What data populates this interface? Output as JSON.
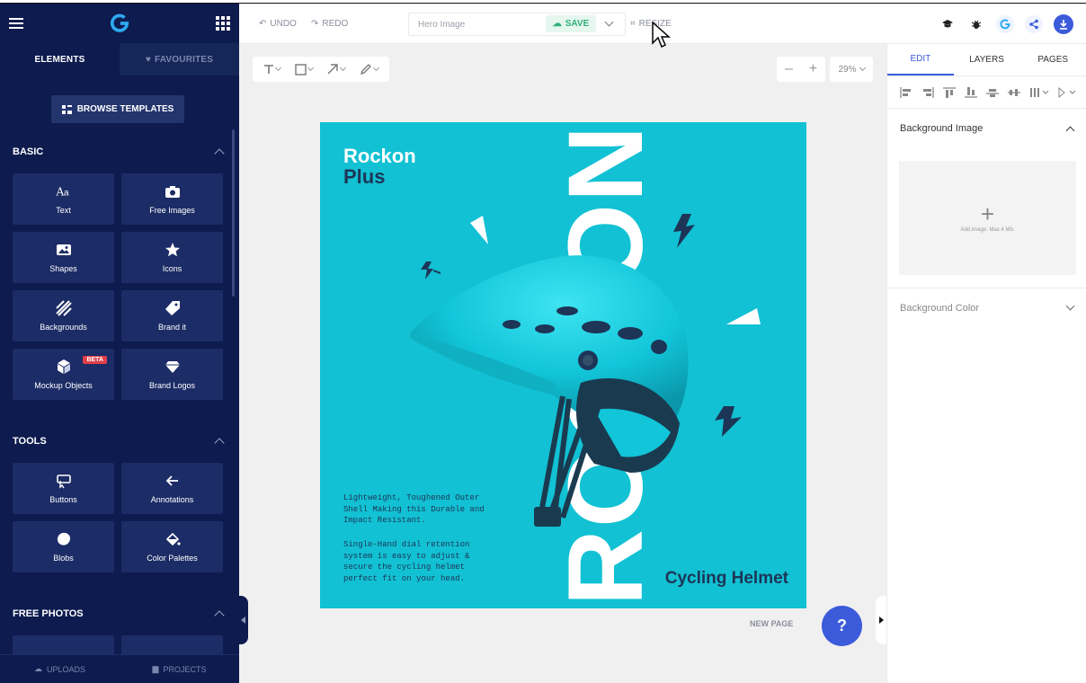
{
  "sidebar": {
    "tabs": {
      "elements": "ELEMENTS",
      "favourites": "FAVOURITES"
    },
    "browse_templates": "BROWSE TEMPLATES",
    "basic": {
      "title": "BASIC",
      "items": [
        {
          "label": "Text",
          "icon": "text-icon"
        },
        {
          "label": "Free Images",
          "icon": "camera-icon"
        },
        {
          "label": "Shapes",
          "icon": "image-icon"
        },
        {
          "label": "Icons",
          "icon": "star-icon"
        },
        {
          "label": "Backgrounds",
          "icon": "stripes-icon"
        },
        {
          "label": "Brand it",
          "icon": "tag-icon"
        },
        {
          "label": "Mockup Objects",
          "icon": "cube-icon",
          "badge": "BETA"
        },
        {
          "label": "Brand Logos",
          "icon": "diamond-icon"
        }
      ]
    },
    "tools": {
      "title": "TOOLS",
      "items": [
        {
          "label": "Buttons",
          "icon": "cursor-box-icon"
        },
        {
          "label": "Annotations",
          "icon": "arrow-left-icon"
        },
        {
          "label": "Blobs",
          "icon": "blob-icon"
        },
        {
          "label": "Color Palettes",
          "icon": "paint-bucket-icon"
        }
      ]
    },
    "free_photos": {
      "title": "FREE PHOTOS"
    },
    "bottom": {
      "uploads": "UPLOADS",
      "projects": "PROJECTS"
    }
  },
  "topbar": {
    "undo": "UNDO",
    "redo": "REDO",
    "doc_name": "Hero Image",
    "save": "SAVE",
    "resize": "RESIZE"
  },
  "canvas": {
    "zoom": "29%",
    "new_page": "NEW PAGE",
    "help": "?"
  },
  "design": {
    "title_line1": "Rockon",
    "title_line2": "Plus",
    "big_word": "ROCKON",
    "para1": "Lightweight, Toughened Outer Shell Making this Durable and Impact Resistant.",
    "para2": "Single-Hand dial retention system is easy to adjust & secure the cycling helmet perfect fit on your head.",
    "footer": "Cycling Helmet",
    "colors": {
      "background": "#12c1d3",
      "dark": "#1d3557"
    }
  },
  "rightpanel": {
    "tabs": [
      "EDIT",
      "LAYERS",
      "PAGES"
    ],
    "bg_image_title": "Background Image",
    "add_image_hint": "Add image. Max 4 Mb.",
    "bg_color_title": "Background Color"
  },
  "colors": {
    "sidebar": "#0d1b4e",
    "accent": "#3b5bdb",
    "save_green": "#30b078"
  }
}
